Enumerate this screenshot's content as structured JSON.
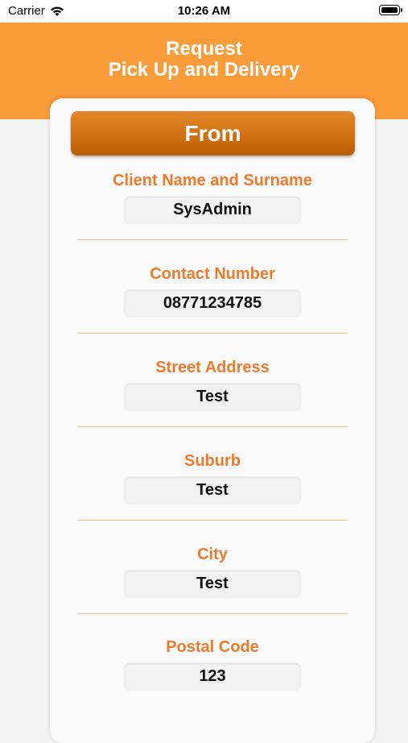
{
  "status_bar": {
    "carrier": "Carrier",
    "time": "10:26 AM"
  },
  "header": {
    "title_line1": "Request",
    "title_line2": "Pick Up and Delivery"
  },
  "section": {
    "title": "From"
  },
  "fields": [
    {
      "label": "Client Name and Surname",
      "value": "SysAdmin"
    },
    {
      "label": "Contact Number",
      "value": "08771234785"
    },
    {
      "label": "Street Address",
      "value": "Test"
    },
    {
      "label": "Suburb",
      "value": "Test"
    },
    {
      "label": "City",
      "value": "Test"
    },
    {
      "label": "Postal Code",
      "value": "123"
    }
  ],
  "colors": {
    "header_bg": "#fb9c3b",
    "label": "#ef7a2b",
    "banner": "#cf6f10"
  }
}
